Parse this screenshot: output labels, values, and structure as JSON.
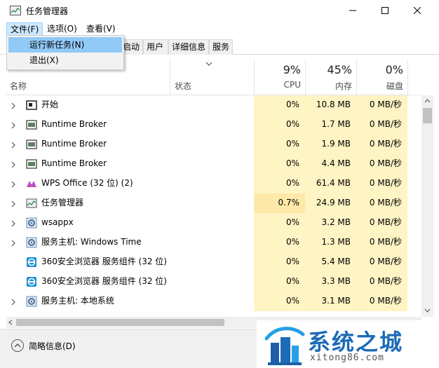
{
  "window": {
    "title": "任务管理器"
  },
  "menubar": [
    {
      "label": "文件(F)",
      "active": true
    },
    {
      "label": "选项(O)",
      "active": false
    },
    {
      "label": "查看(V)",
      "active": false
    }
  ],
  "tabs": [
    "启动",
    "用户",
    "详细信息",
    "服务"
  ],
  "file_menu": [
    {
      "label": "运行新任务(N)",
      "highlighted": true
    },
    {
      "label": "退出(X)",
      "highlighted": false
    }
  ],
  "columns": {
    "name": "名称",
    "status": "状态",
    "cpu": {
      "percent": "9%",
      "label": "CPU"
    },
    "memory": {
      "percent": "45%",
      "label": "内存"
    },
    "disk": {
      "percent": "0%",
      "label": "磁盘"
    }
  },
  "processes": [
    {
      "name": "开始",
      "icon": "start-icon",
      "expandable": true,
      "cpu": "0%",
      "memory": "10.8 MB",
      "disk": "0 MB/秒"
    },
    {
      "name": "Runtime Broker",
      "icon": "app-window-icon",
      "expandable": true,
      "cpu": "0%",
      "memory": "1.7 MB",
      "disk": "0 MB/秒"
    },
    {
      "name": "Runtime Broker",
      "icon": "app-window-icon",
      "expandable": true,
      "cpu": "0%",
      "memory": "1.9 MB",
      "disk": "0 MB/秒"
    },
    {
      "name": "Runtime Broker",
      "icon": "app-window-icon",
      "expandable": true,
      "cpu": "0%",
      "memory": "4.4 MB",
      "disk": "0 MB/秒"
    },
    {
      "name": "WPS Office (32 位) (2)",
      "icon": "wps-icon",
      "expandable": true,
      "cpu": "0%",
      "memory": "61.4 MB",
      "disk": "0 MB/秒"
    },
    {
      "name": "任务管理器",
      "icon": "task-manager-icon",
      "expandable": true,
      "cpu": "0.7%",
      "memory": "24.9 MB",
      "disk": "0 MB/秒"
    },
    {
      "name": "wsappx",
      "icon": "gear-icon",
      "expandable": true,
      "cpu": "0%",
      "memory": "3.2 MB",
      "disk": "0 MB/秒"
    },
    {
      "name": "服务主机: Windows Time",
      "icon": "gear-icon",
      "expandable": true,
      "cpu": "0%",
      "memory": "1.3 MB",
      "disk": "0 MB/秒"
    },
    {
      "name": "360安全浏览器 服务组件 (32 位)",
      "icon": "360-browser-icon",
      "expandable": false,
      "cpu": "0%",
      "memory": "5.4 MB",
      "disk": "0 MB/秒"
    },
    {
      "name": "360安全浏览器 服务组件 (32 位)",
      "icon": "360-browser-icon",
      "expandable": false,
      "cpu": "0%",
      "memory": "3.3 MB",
      "disk": "0 MB/秒"
    },
    {
      "name": "服务主机: 本地系统",
      "icon": "gear-icon",
      "expandable": true,
      "cpu": "0%",
      "memory": "3.1 MB",
      "disk": "0 MB/秒"
    }
  ],
  "footer": {
    "fewer_details": "简略信息(D)"
  },
  "watermark": {
    "text_cn": "系统之城",
    "text_en": "xitong86.com"
  },
  "colors": {
    "usage_cell": "#fff4c4",
    "usage_cell_highlight": "#ffe9a8",
    "menu_active": "#cce8ff",
    "menu_highlight": "#91c9f7",
    "watermark_blue": "#1c6bb7"
  }
}
